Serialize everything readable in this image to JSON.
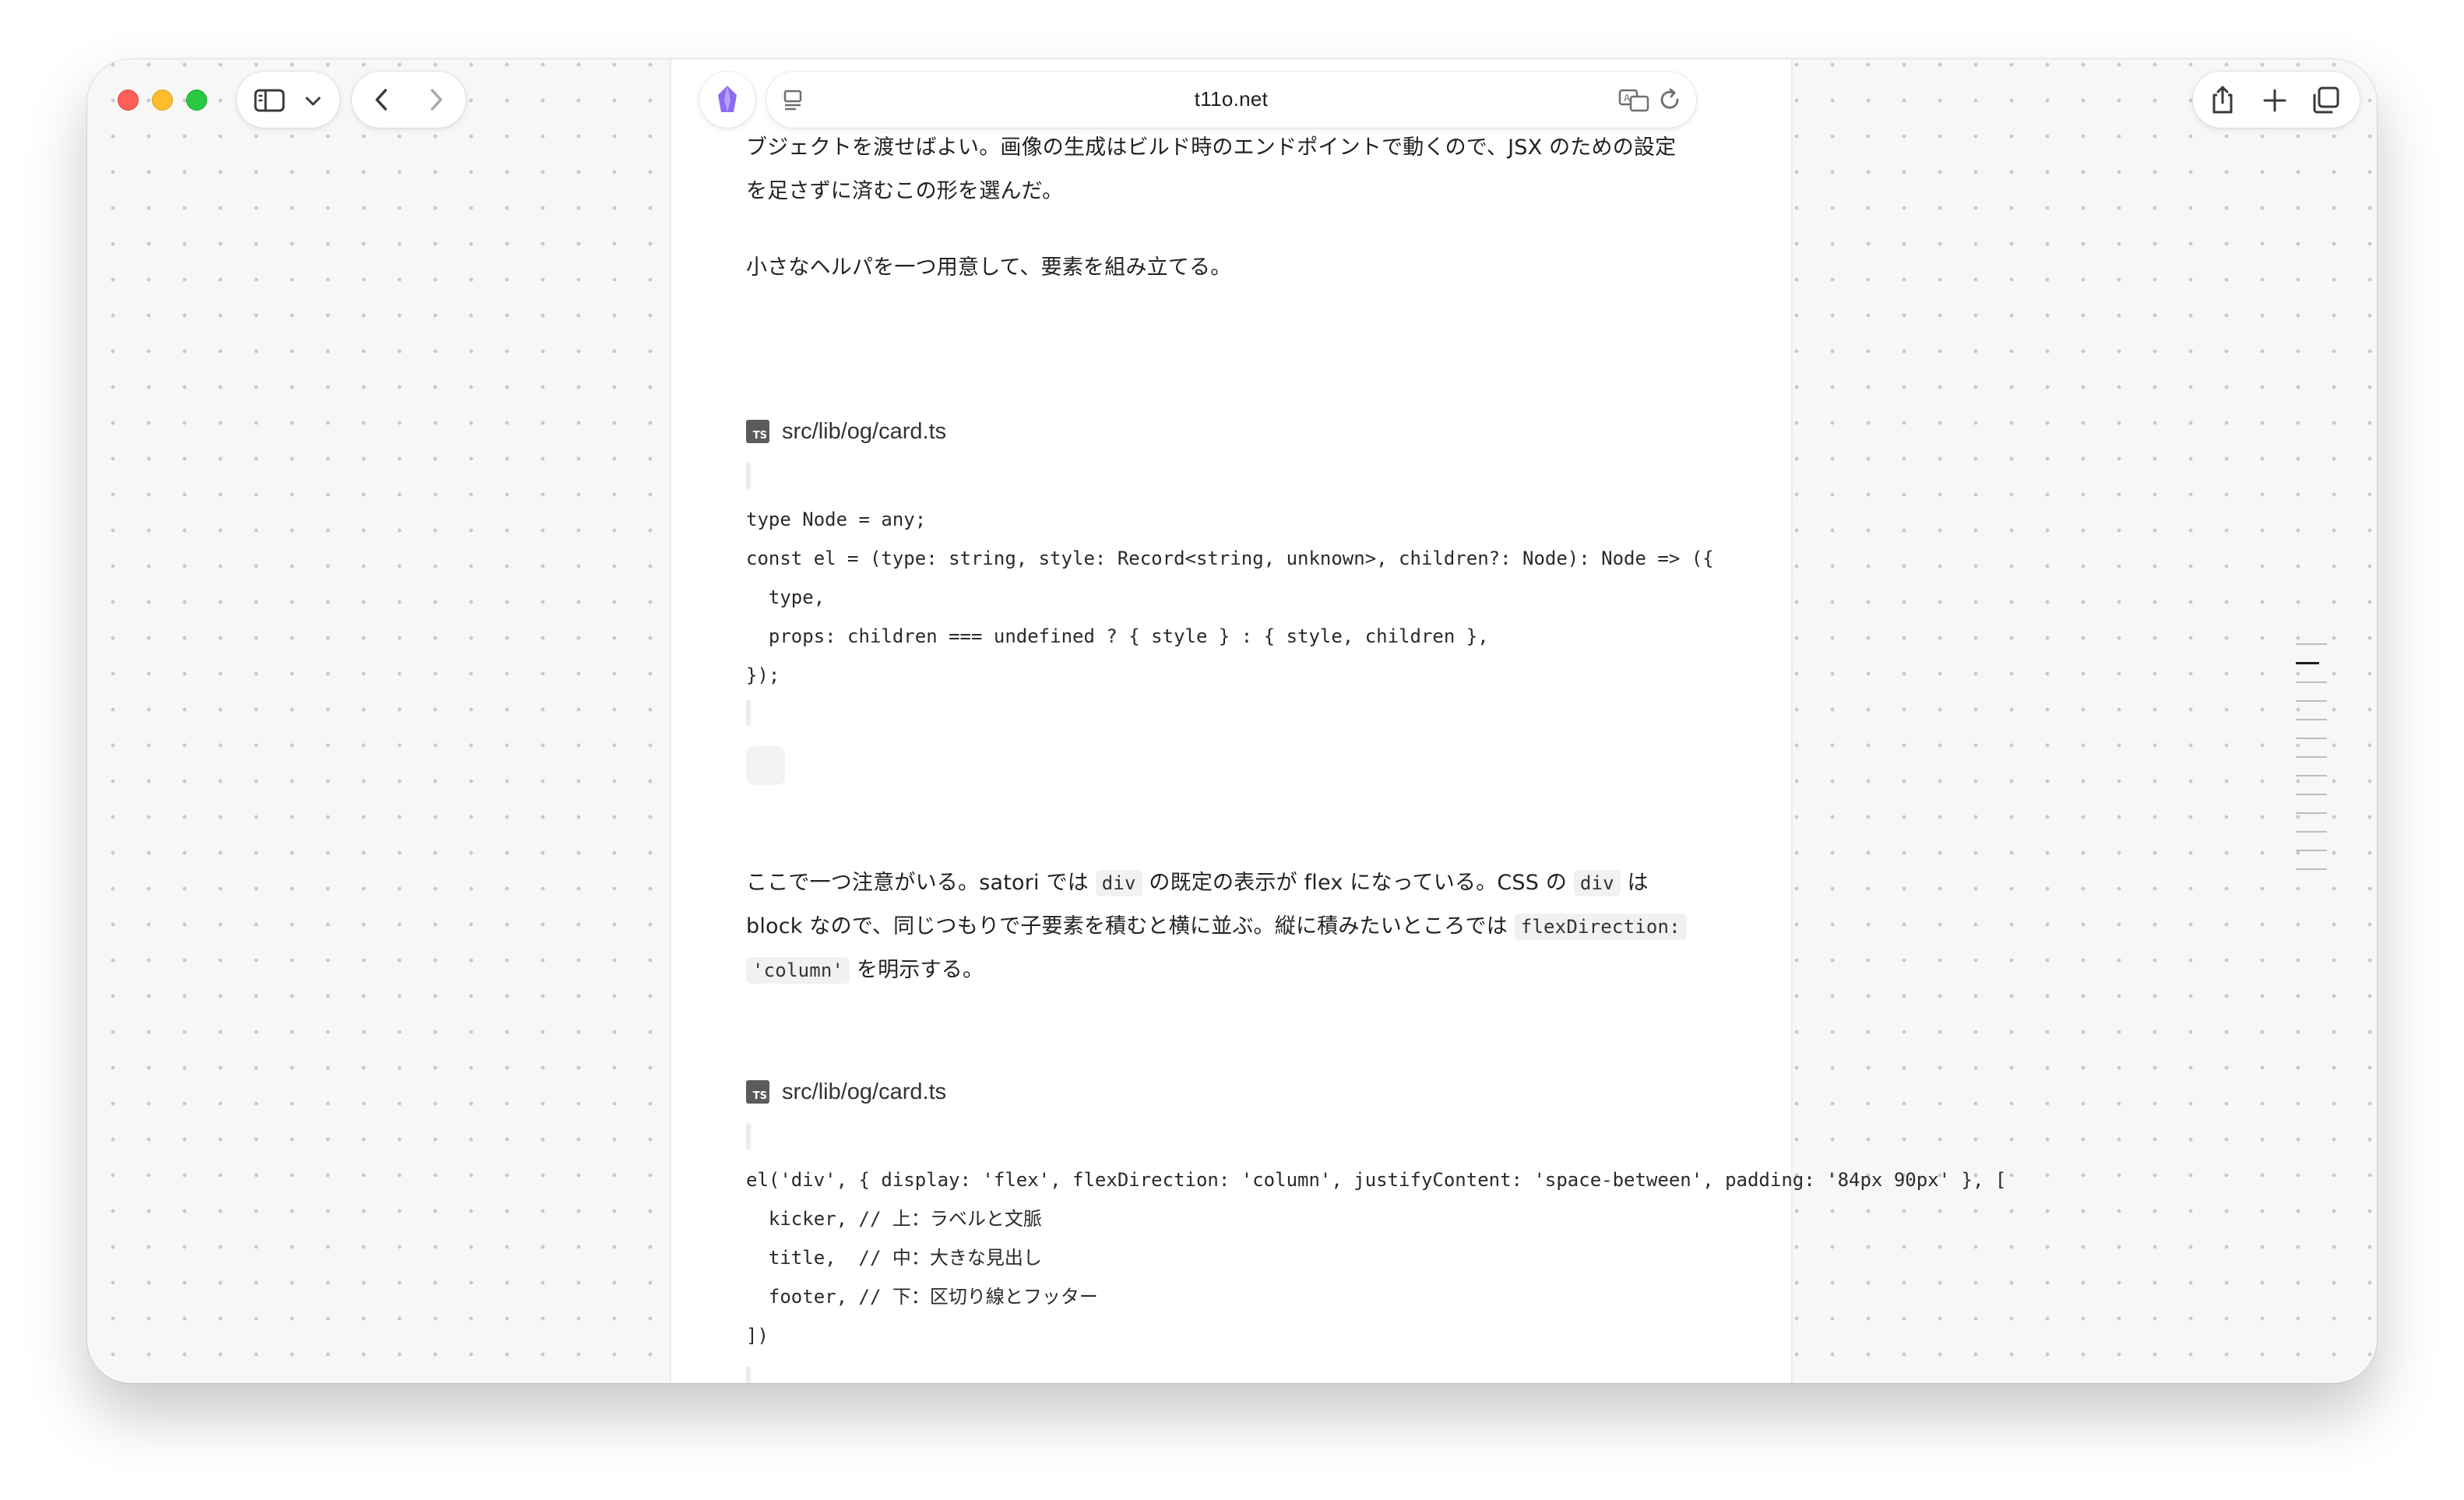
{
  "browser": {
    "url": "t11o.net"
  },
  "article": {
    "intro_lines": [
      "ブジェクトを渡せばよい。画像の生成はビルド時のエンドポイントで動くので、JSX のための設定",
      "を足さずに済むこの形を選んだ。"
    ],
    "helper_sentence": "小さなヘルパを一つ用意して、要素を組み立てる。",
    "code_block_1": {
      "filename": "src/lib/og/card.ts",
      "badge": "TS",
      "lines": [
        "type Node = any;",
        "const el = (type: string, style: Record<string, unknown>, children?: Node): Node => ({",
        "  type,",
        "  props: children === undefined ? { style } : { style, children },",
        "});"
      ]
    },
    "note": {
      "l1_a": "ここで一つ注意がいる。satori では ",
      "l1_code1": "div",
      "l1_b": " の既定の表示が flex になっている。CSS の ",
      "l1_code2": "div",
      "l1_c": " は",
      "l2_a": "block なので、同じつもりで子要素を積むと横に並ぶ。縦に積みたいところでは ",
      "l2_code": "flexDirection:",
      "l3_code": "'column'",
      "l3_b": " を明示する。"
    },
    "code_block_2": {
      "filename": "src/lib/og/card.ts",
      "badge": "TS",
      "lines": [
        "el('div', { display: 'flex', flexDirection: 'column', justifyContent: 'space-between', padding: '84px 90px' }, [",
        "  kicker, // 上：ラベルと文脈",
        "  title,  // 中：大きな見出し",
        "  footer, // 下：区切り線とフッター",
        "])"
      ]
    }
  },
  "toc": {
    "entries": 13,
    "active_index": 1
  }
}
